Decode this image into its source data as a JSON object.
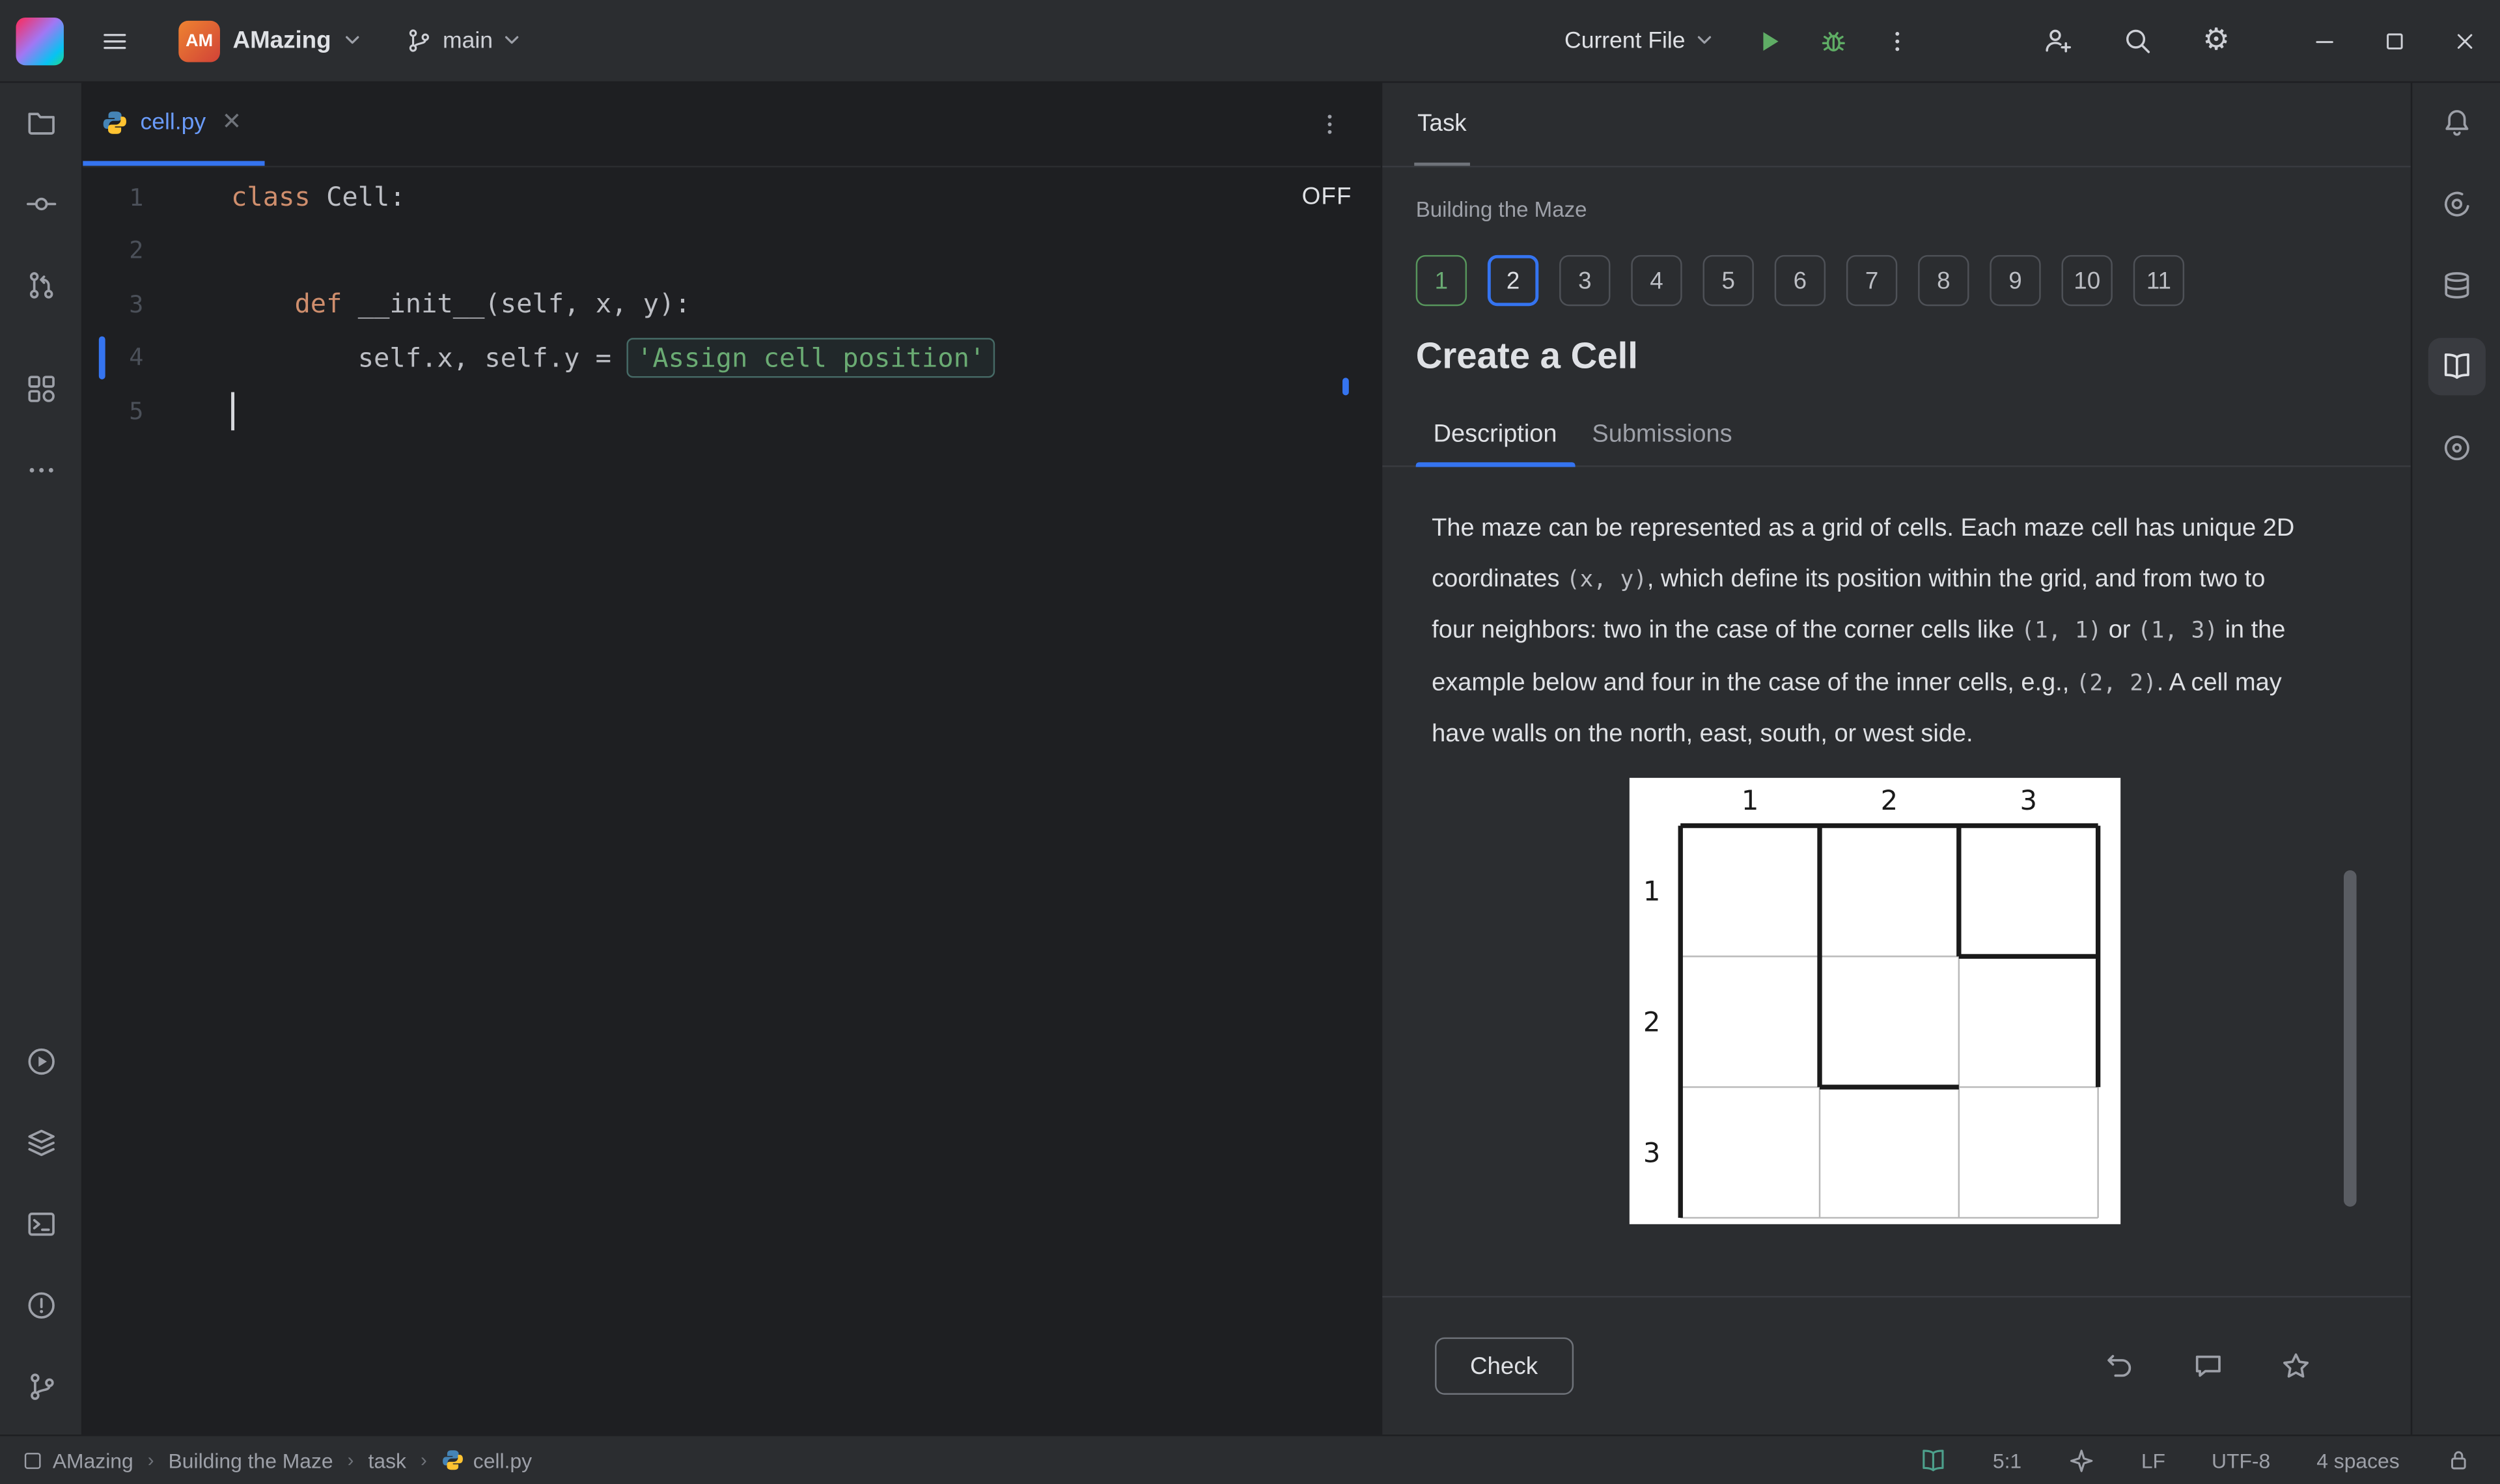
{
  "colors": {
    "accent_blue": "#3574f0",
    "green": "#57965c",
    "panel_bg": "#2b2d30",
    "editor_bg": "#1e1f22",
    "keyword_orange": "#cf8e6d",
    "string_green": "#6aab73"
  },
  "titlebar": {
    "project": "AMazing",
    "project_badge": "AM",
    "branch": "main",
    "run_config": "Current File",
    "icons": [
      "hamburger-menu",
      "chevron-down",
      "git-branch",
      "run",
      "debug",
      "more-kebab",
      "add-user",
      "search",
      "settings",
      "minimize",
      "maximize",
      "close"
    ]
  },
  "left_toolbar_icons": [
    "project-folder",
    "commit",
    "pull-request",
    "structure",
    "more",
    "run-circle",
    "services",
    "terminal",
    "problems",
    "version-control"
  ],
  "right_toolbar_icons": [
    "notifications-bell",
    "ai-assistant",
    "database",
    "course-book",
    "python-packages"
  ],
  "editor": {
    "tab": "cell.py",
    "off_label": "OFF",
    "lines": [
      {
        "num": "1",
        "segments": [
          {
            "t": "class",
            "c": "keyword"
          },
          {
            "t": " Cell:",
            "c": "plain"
          }
        ]
      },
      {
        "num": "2",
        "segments": []
      },
      {
        "num": "3",
        "segments": [
          {
            "t": "    ",
            "c": "plain"
          },
          {
            "t": "def",
            "c": "keyword"
          },
          {
            "t": " __init__(self, x, y):",
            "c": "plain"
          }
        ]
      },
      {
        "num": "4",
        "vcs": true,
        "segments": [
          {
            "t": "        self.x, self.y = ",
            "c": "plain"
          },
          {
            "t": "'Assign cell position'",
            "c": "string-box"
          }
        ]
      },
      {
        "num": "5",
        "caret": true,
        "segments": []
      }
    ]
  },
  "task_panel": {
    "tool_tab": "Task",
    "lesson": "Building the Maze",
    "steps": [
      {
        "label": "1",
        "state": "done"
      },
      {
        "label": "2",
        "state": "current"
      },
      {
        "label": "3",
        "state": "default"
      },
      {
        "label": "4",
        "state": "default"
      },
      {
        "label": "5",
        "state": "default"
      },
      {
        "label": "6",
        "state": "default"
      },
      {
        "label": "7",
        "state": "default"
      },
      {
        "label": "8",
        "state": "default"
      },
      {
        "label": "9",
        "state": "default"
      },
      {
        "label": "10",
        "state": "default"
      },
      {
        "label": "11",
        "state": "default"
      }
    ],
    "title": "Create a Cell",
    "tabs": [
      "Description",
      "Submissions"
    ],
    "description": [
      {
        "t": "The maze can be represented as a grid of cells. Each maze cell has unique 2D coordinates "
      },
      {
        "t": "(x, y)",
        "code": true
      },
      {
        "t": ", which define its position within the grid, and from two to four neighbors: two in the case of the corner cells like "
      },
      {
        "t": "(1, 1)",
        "code": true
      },
      {
        "t": " or "
      },
      {
        "t": "(1, 3)",
        "code": true
      },
      {
        "t": " in the example below and four in the case of the inner cells, e.g., "
      },
      {
        "t": "(2, 2)",
        "code": true
      },
      {
        "t": ". A cell may have walls on the north, east, south, or west side."
      }
    ],
    "check_label": "Check",
    "footer_icons": [
      "reset",
      "comment",
      "favorite-star"
    ]
  },
  "maze": {
    "col_labels": [
      "1",
      "2",
      "3"
    ],
    "row_labels": [
      "1",
      "2",
      "3"
    ],
    "thick_walls": [
      [
        0,
        0,
        3,
        0
      ],
      [
        0,
        0,
        0,
        3
      ],
      [
        1,
        0,
        1,
        2
      ],
      [
        2,
        0,
        2,
        1
      ],
      [
        3,
        0,
        3,
        2
      ],
      [
        2,
        1,
        3,
        1
      ],
      [
        1,
        2,
        2,
        2
      ]
    ],
    "thin_walls": [
      [
        0,
        1,
        2,
        1
      ],
      [
        0,
        2,
        1,
        2
      ],
      [
        2,
        2,
        3,
        2
      ],
      [
        1,
        2,
        1,
        3
      ],
      [
        2,
        1,
        2,
        3
      ],
      [
        3,
        2,
        3,
        3
      ],
      [
        0,
        3,
        3,
        3
      ]
    ]
  },
  "statusbar": {
    "breadcrumbs": [
      "AMazing",
      "Building the Maze",
      "task",
      "cell.py"
    ],
    "cursor": "5:1",
    "line_ending": "LF",
    "encoding": "UTF-8",
    "indent": "4 spaces",
    "icons": [
      "course-book",
      "ai-status",
      "lock"
    ]
  }
}
